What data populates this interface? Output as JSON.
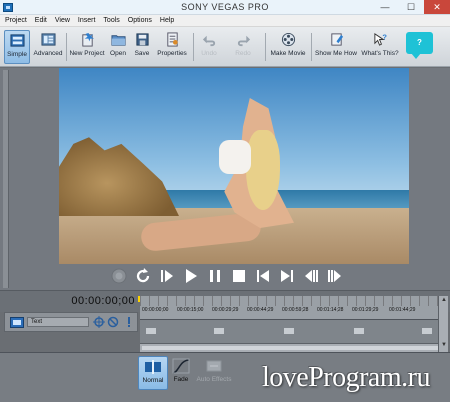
{
  "window": {
    "title": "SONY VEGAS PRO",
    "minimize": "—",
    "maximize": "☐",
    "close": "✕"
  },
  "menu": [
    "Project",
    "Edit",
    "View",
    "Insert",
    "Tools",
    "Options",
    "Help"
  ],
  "toolbar": {
    "simple": "Simple",
    "advanced": "Advanced",
    "new_project": "New Project",
    "open": "Open",
    "save": "Save",
    "properties": "Properties",
    "undo": "Undo",
    "redo": "Redo",
    "make_movie": "Make Movie",
    "show_me_how": "Show Me How",
    "whats_this": "What's This?",
    "help_bubble": "?"
  },
  "timeline": {
    "timecode": "00:00:00;00",
    "ruler_ticks": [
      "00:00:00;00",
      "00:00:15;00",
      "00:00:29;29",
      "00:00:44;29",
      "00:00:59;28",
      "00:01:14;28",
      "00:01:29;29",
      "00:01:44;29"
    ],
    "track_name": "Text"
  },
  "effects": {
    "normal": "Normal",
    "fade": "Fade",
    "auto_effects": "Auto Effects"
  },
  "watermark": "loveProgram.ru",
  "colors": {
    "accent": "#1ec2d6",
    "active": "#8fbde6",
    "close": "#c9473b"
  }
}
